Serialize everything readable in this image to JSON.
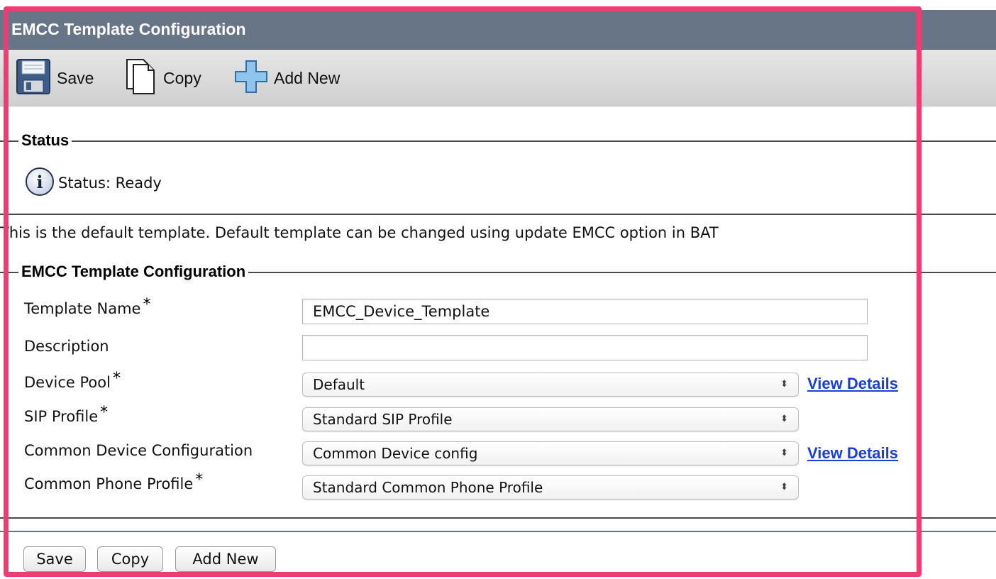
{
  "window": {
    "title": "EMCC Template Configuration"
  },
  "toolbar": {
    "save_label": "Save",
    "copy_label": "Copy",
    "add_new_label": "Add New"
  },
  "status_section": {
    "legend": "Status",
    "status_text": "Status: Ready"
  },
  "info_text": "This is the default template. Default template can be changed using update EMCC option in BAT",
  "config_section": {
    "legend": "EMCC Template Configuration",
    "fields": {
      "template_name": {
        "label": "Template Name",
        "required": "*",
        "value": "EMCC_Device_Template"
      },
      "description": {
        "label": "Description",
        "value": ""
      },
      "device_pool": {
        "label": "Device Pool",
        "required": "*",
        "value": "Default",
        "link": "View Details"
      },
      "sip_profile": {
        "label": "SIP Profile",
        "required": "*",
        "value": "Standard SIP Profile"
      },
      "common_device_config": {
        "label": "Common Device Configuration",
        "value": "Common Device config",
        "link": "View Details"
      },
      "common_phone_profile": {
        "label": "Common Phone Profile",
        "required": "*",
        "value": "Standard Common Phone Profile"
      }
    }
  },
  "bottom_buttons": {
    "save_label": "Save",
    "copy_label": "Copy",
    "add_new_label": "Add New"
  },
  "icons": {
    "save": "floppy-disk-icon",
    "copy": "copy-document-icon",
    "add_new": "plus-icon",
    "status": "info-icon",
    "select_arrow": "updown-arrow-icon"
  },
  "colors": {
    "title_bar": "#677587",
    "link": "#1a3fd6",
    "highlight_frame": "#f03c72"
  }
}
